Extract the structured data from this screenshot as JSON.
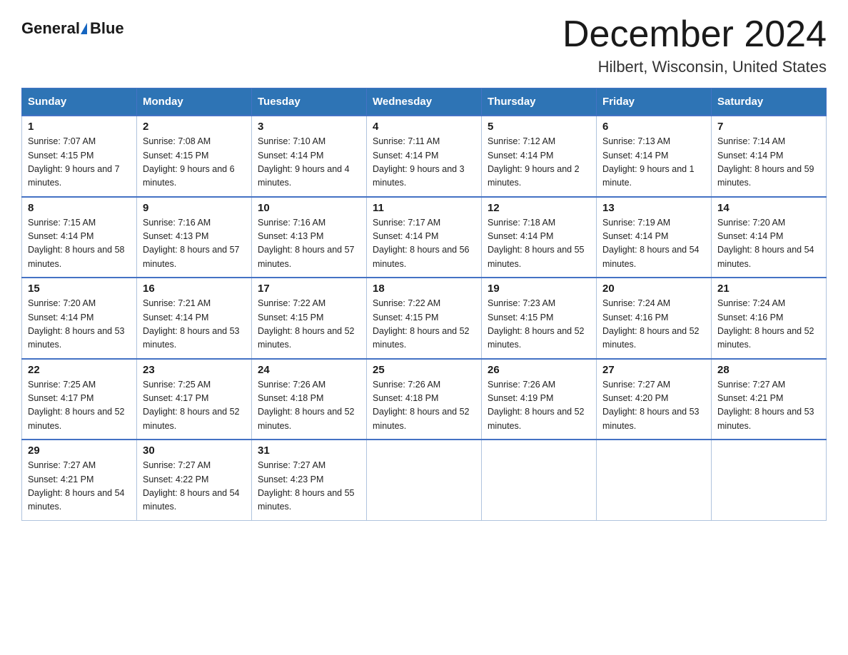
{
  "logo": {
    "general": "General",
    "blue": "Blue",
    "arrowColor": "#1565c0"
  },
  "header": {
    "title": "December 2024",
    "subtitle": "Hilbert, Wisconsin, United States"
  },
  "days": [
    "Sunday",
    "Monday",
    "Tuesday",
    "Wednesday",
    "Thursday",
    "Friday",
    "Saturday"
  ],
  "weeks": [
    [
      {
        "num": "1",
        "sunrise": "7:07 AM",
        "sunset": "4:15 PM",
        "daylight": "9 hours and 7 minutes."
      },
      {
        "num": "2",
        "sunrise": "7:08 AM",
        "sunset": "4:15 PM",
        "daylight": "9 hours and 6 minutes."
      },
      {
        "num": "3",
        "sunrise": "7:10 AM",
        "sunset": "4:14 PM",
        "daylight": "9 hours and 4 minutes."
      },
      {
        "num": "4",
        "sunrise": "7:11 AM",
        "sunset": "4:14 PM",
        "daylight": "9 hours and 3 minutes."
      },
      {
        "num": "5",
        "sunrise": "7:12 AM",
        "sunset": "4:14 PM",
        "daylight": "9 hours and 2 minutes."
      },
      {
        "num": "6",
        "sunrise": "7:13 AM",
        "sunset": "4:14 PM",
        "daylight": "9 hours and 1 minute."
      },
      {
        "num": "7",
        "sunrise": "7:14 AM",
        "sunset": "4:14 PM",
        "daylight": "8 hours and 59 minutes."
      }
    ],
    [
      {
        "num": "8",
        "sunrise": "7:15 AM",
        "sunset": "4:14 PM",
        "daylight": "8 hours and 58 minutes."
      },
      {
        "num": "9",
        "sunrise": "7:16 AM",
        "sunset": "4:13 PM",
        "daylight": "8 hours and 57 minutes."
      },
      {
        "num": "10",
        "sunrise": "7:16 AM",
        "sunset": "4:13 PM",
        "daylight": "8 hours and 57 minutes."
      },
      {
        "num": "11",
        "sunrise": "7:17 AM",
        "sunset": "4:14 PM",
        "daylight": "8 hours and 56 minutes."
      },
      {
        "num": "12",
        "sunrise": "7:18 AM",
        "sunset": "4:14 PM",
        "daylight": "8 hours and 55 minutes."
      },
      {
        "num": "13",
        "sunrise": "7:19 AM",
        "sunset": "4:14 PM",
        "daylight": "8 hours and 54 minutes."
      },
      {
        "num": "14",
        "sunrise": "7:20 AM",
        "sunset": "4:14 PM",
        "daylight": "8 hours and 54 minutes."
      }
    ],
    [
      {
        "num": "15",
        "sunrise": "7:20 AM",
        "sunset": "4:14 PM",
        "daylight": "8 hours and 53 minutes."
      },
      {
        "num": "16",
        "sunrise": "7:21 AM",
        "sunset": "4:14 PM",
        "daylight": "8 hours and 53 minutes."
      },
      {
        "num": "17",
        "sunrise": "7:22 AM",
        "sunset": "4:15 PM",
        "daylight": "8 hours and 52 minutes."
      },
      {
        "num": "18",
        "sunrise": "7:22 AM",
        "sunset": "4:15 PM",
        "daylight": "8 hours and 52 minutes."
      },
      {
        "num": "19",
        "sunrise": "7:23 AM",
        "sunset": "4:15 PM",
        "daylight": "8 hours and 52 minutes."
      },
      {
        "num": "20",
        "sunrise": "7:24 AM",
        "sunset": "4:16 PM",
        "daylight": "8 hours and 52 minutes."
      },
      {
        "num": "21",
        "sunrise": "7:24 AM",
        "sunset": "4:16 PM",
        "daylight": "8 hours and 52 minutes."
      }
    ],
    [
      {
        "num": "22",
        "sunrise": "7:25 AM",
        "sunset": "4:17 PM",
        "daylight": "8 hours and 52 minutes."
      },
      {
        "num": "23",
        "sunrise": "7:25 AM",
        "sunset": "4:17 PM",
        "daylight": "8 hours and 52 minutes."
      },
      {
        "num": "24",
        "sunrise": "7:26 AM",
        "sunset": "4:18 PM",
        "daylight": "8 hours and 52 minutes."
      },
      {
        "num": "25",
        "sunrise": "7:26 AM",
        "sunset": "4:18 PM",
        "daylight": "8 hours and 52 minutes."
      },
      {
        "num": "26",
        "sunrise": "7:26 AM",
        "sunset": "4:19 PM",
        "daylight": "8 hours and 52 minutes."
      },
      {
        "num": "27",
        "sunrise": "7:27 AM",
        "sunset": "4:20 PM",
        "daylight": "8 hours and 53 minutes."
      },
      {
        "num": "28",
        "sunrise": "7:27 AM",
        "sunset": "4:21 PM",
        "daylight": "8 hours and 53 minutes."
      }
    ],
    [
      {
        "num": "29",
        "sunrise": "7:27 AM",
        "sunset": "4:21 PM",
        "daylight": "8 hours and 54 minutes."
      },
      {
        "num": "30",
        "sunrise": "7:27 AM",
        "sunset": "4:22 PM",
        "daylight": "8 hours and 54 minutes."
      },
      {
        "num": "31",
        "sunrise": "7:27 AM",
        "sunset": "4:23 PM",
        "daylight": "8 hours and 55 minutes."
      },
      null,
      null,
      null,
      null
    ]
  ]
}
